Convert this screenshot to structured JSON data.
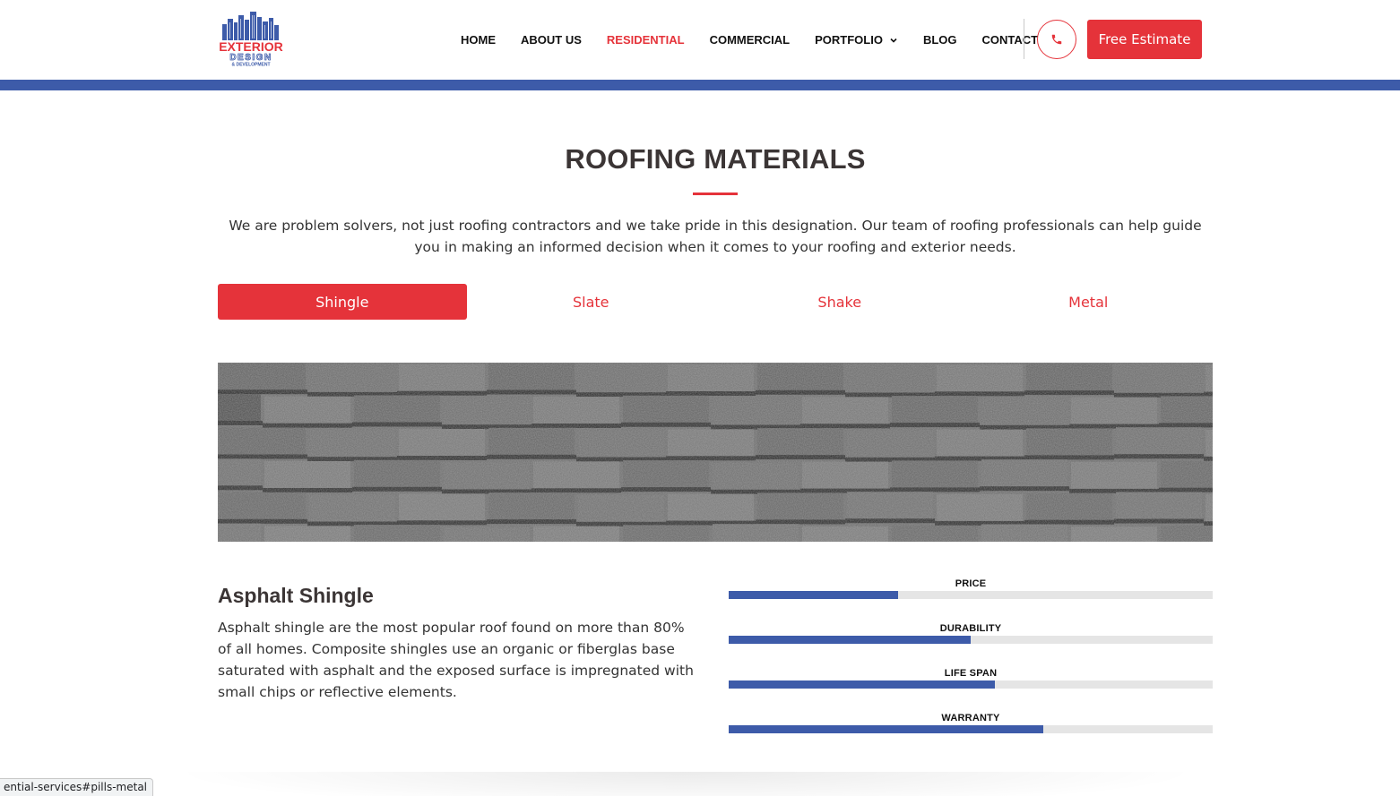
{
  "brand": {
    "logo_line1": "EXTERIOR",
    "logo_line2": "DESIGN",
    "logo_line3": "& DEVELOPMENT",
    "accent_color": "#e5333a",
    "blue_color": "#3d5ba9"
  },
  "nav": {
    "items": [
      {
        "label": "HOME",
        "active": false
      },
      {
        "label": "ABOUT US",
        "active": false
      },
      {
        "label": "RESIDENTIAL",
        "active": true
      },
      {
        "label": "COMMERCIAL",
        "active": false
      },
      {
        "label": "PORTFOLIO",
        "active": false,
        "has_dropdown": true
      },
      {
        "label": "BLOG",
        "active": false
      },
      {
        "label": "CONTACT",
        "active": false
      }
    ],
    "phone_icon": "phone-icon",
    "cta_label": "Free Estimate"
  },
  "section": {
    "title": "ROOFING MATERIALS",
    "intro": "We are problem solvers, not just roofing contractors and we take pride in this designation. Our team of roofing professionals can help guide you in making an informed decision when it comes to your roofing and exterior needs."
  },
  "tabs": [
    {
      "label": "Shingle",
      "active": true
    },
    {
      "label": "Slate",
      "active": false
    },
    {
      "label": "Shake",
      "active": false
    },
    {
      "label": "Metal",
      "active": false
    }
  ],
  "material": {
    "title": "Asphalt Shingle",
    "description": "Asphalt shingle are the most popular roof found on more than 80% of all homes. Composite shingles use an organic or fiberglas base saturated with asphalt and the exposed surface is impregnated with small chips or reflective elements."
  },
  "ratings": [
    {
      "label": "PRICE",
      "percent": 35
    },
    {
      "label": "DURABILITY",
      "percent": 50
    },
    {
      "label": "LIFE SPAN",
      "percent": 55
    },
    {
      "label": "WARRANTY",
      "percent": 65
    }
  ],
  "status_bar": {
    "url": "ential-services#pills-metal"
  }
}
